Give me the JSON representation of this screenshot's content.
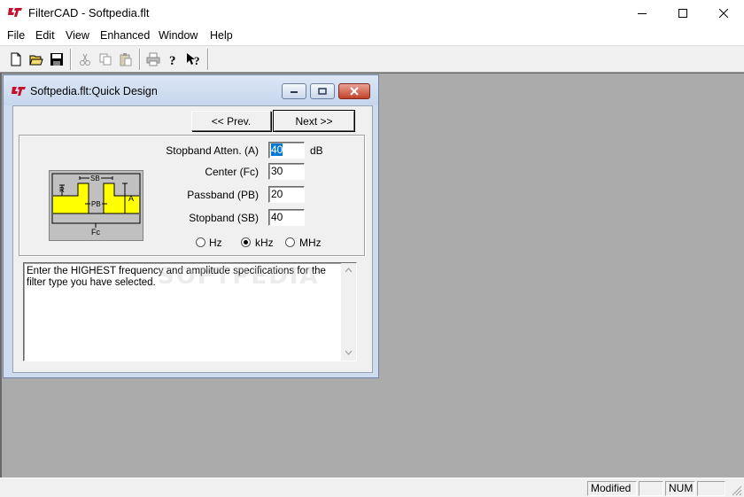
{
  "app": {
    "title": "FilterCAD - Softpedia.flt",
    "logo_icon": "lt-logo-icon",
    "accent_color": "#c8102e"
  },
  "menu": {
    "items": [
      "File",
      "Edit",
      "View",
      "Enhanced",
      "Window",
      "Help"
    ]
  },
  "toolbar": {
    "buttons": [
      "new-file-icon",
      "open-folder-icon",
      "save-disk-icon",
      "cut-icon",
      "copy-icon",
      "paste-icon",
      "print-icon",
      "help-icon",
      "context-help-icon"
    ]
  },
  "child": {
    "title": "Softpedia.flt:Quick Design",
    "prev_label": "<< Prev.",
    "next_label": "Next >>",
    "diagram": {
      "sb_label": "SB",
      "pb_label": "PB",
      "r_label": "R",
      "a_label": "A",
      "fc_label": "Fc"
    },
    "fields": [
      {
        "label": "Stopband Atten. (A)",
        "value": "40",
        "unit": "dB"
      },
      {
        "label": "Center (Fc)",
        "value": "30"
      },
      {
        "label": "Passband (PB)",
        "value": "20"
      },
      {
        "label": "Stopband (SB)",
        "value": "40"
      }
    ],
    "units": {
      "options": [
        "Hz",
        "kHz",
        "MHz"
      ],
      "selected": "kHz"
    },
    "description": "Enter the HIGHEST frequency and amplitude specifications for the filter type you have selected.",
    "watermark": "SOFTPEDIA"
  },
  "status": {
    "modified": "Modified",
    "num": "NUM"
  },
  "colors": {
    "diagram_fill": "#ffff00",
    "selection": "#0078d7",
    "mdi_background": "#ababab"
  }
}
